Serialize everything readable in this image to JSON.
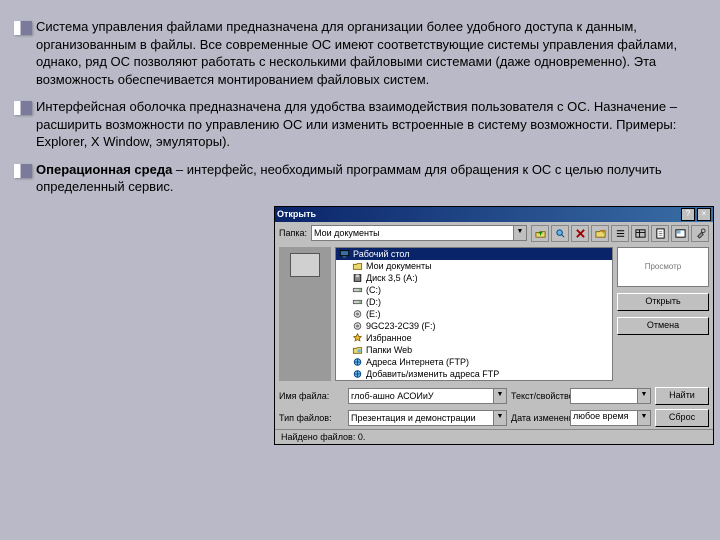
{
  "para1": "Система управления файлами предназначена для организации более удобного доступа к данным, организованным в файлы. Все современные ОС имеют соответствующие системы управления файлами, однако, ряд ОС позволяют работать с несколькими файловыми системами (даже одновременно). Эта возможность обеспечивается монтированием файловых систем.",
  "para2": "Интерфейсная оболочка предназначена для удобства взаимодействия пользователя с ОС. Назначение – расширить возможности по управлению ОС или изменить встроенные в систему возможности. Примеры: Explorer, X Window, эмуляторы).",
  "para3_bold": "Операционная среда",
  "para3_rest": " – интерфейс, необходимый программам для обращения к ОС с целью получить определенный сервис.",
  "dialog": {
    "title": "Открыть",
    "lookin_label": "Папка:",
    "lookin_value": "Мои документы",
    "tree": [
      {
        "label": "Рабочий стол",
        "sel": true,
        "icon": "desktop"
      },
      {
        "label": "Мои документы",
        "icon": "folder",
        "indent": 1
      },
      {
        "label": "Диск 3,5 (A:)",
        "icon": "floppy",
        "indent": 1
      },
      {
        "label": "(C:)",
        "icon": "drive",
        "indent": 1
      },
      {
        "label": "(D:)",
        "icon": "drive",
        "indent": 1
      },
      {
        "label": "(E:)",
        "icon": "cd",
        "indent": 1
      },
      {
        "label": "9GC23-2C39 (F:)",
        "icon": "cd",
        "indent": 1
      },
      {
        "label": "Избранное",
        "icon": "star",
        "indent": 1
      },
      {
        "label": "Папки Web",
        "icon": "web",
        "indent": 1
      },
      {
        "label": "Адреса Интернета (FTP)",
        "icon": "web",
        "indent": 1
      },
      {
        "label": "Добавить/изменить адреса FTP",
        "icon": "web",
        "indent": 1
      }
    ],
    "preview_label": "Просмотр",
    "open_btn": "Открыть",
    "cancel_btn": "Отмена",
    "find_btn": "Найти",
    "reset_btn": "Сброс",
    "row1_label": "Имя файла:",
    "row1_value": "глоб-ашно АСОИиУ",
    "row1_label2": "Текст/свойство:",
    "row1_value2": "",
    "row2_label": "Тип файлов:",
    "row2_value": "Презентация и демонстрации",
    "row2_label2": "Дата изменения:",
    "row2_value2": "любое время",
    "status": "Найдено файлов: 0."
  }
}
